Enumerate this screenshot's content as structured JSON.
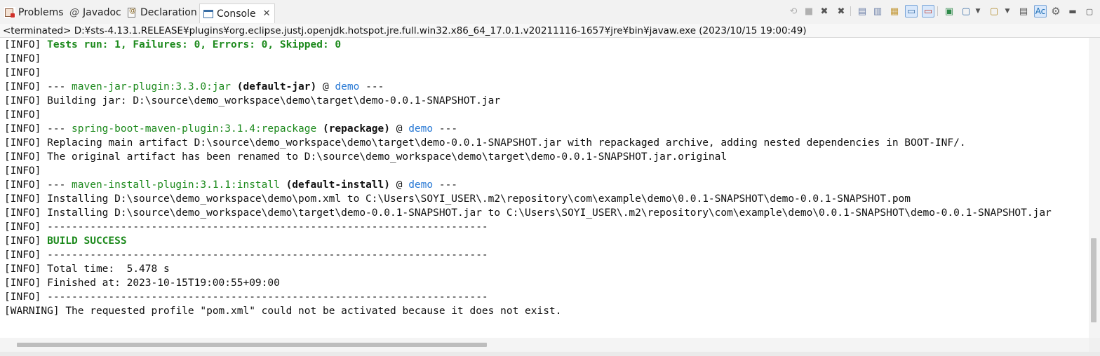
{
  "tabs": {
    "problems": "Problems",
    "javadoc": "Javadoc",
    "declaration": "Declaration",
    "console": "Console",
    "close": "✕"
  },
  "toolbar_icons": [
    "remove-launch-icon",
    "terminate-icon",
    "remove-all-terminated-icon",
    "remove-all-icon",
    "scroll-lock-icon",
    "word-wrap-icon",
    "show-when-stdout-icon",
    "show-when-stderr-icon",
    "pin-console-icon",
    "display-selected-console-icon",
    "open-console-icon",
    "view-menu-icon",
    "settings-icon",
    "minimize-icon",
    "maximize-icon"
  ],
  "status": "<terminated> D:¥sts-4.13.1.RELEASE¥plugins¥org.eclipse.justj.openjdk.hotspot.jre.full.win32.x86_64_17.0.1.v20211116-1657¥jre¥bin¥javaw.exe  (2023/10/15 19:00:49)",
  "console": {
    "prefix": "[INFO] ",
    "warn_prefix": "[WARNING] ",
    "tests_line": "Tests run: 1, Failures: 0, Errors: 0, Skipped: 0",
    "jar_plugin": {
      "dashes": "--- ",
      "plugin": "maven-jar-plugin:3.3.0:jar",
      "goal": "(default-jar)",
      "at": " @ ",
      "project": "demo",
      "tail": " ---"
    },
    "building_jar": "Building jar: D:\\source\\demo_workspace\\demo\\target\\demo-0.0.1-SNAPSHOT.jar",
    "boot_plugin": {
      "dashes": "--- ",
      "plugin": "spring-boot-maven-plugin:3.1.4:repackage",
      "goal": "(repackage)",
      "at": " @ ",
      "project": "demo",
      "tail": " ---"
    },
    "replacing": "Replacing main artifact D:\\source\\demo_workspace\\demo\\target\\demo-0.0.1-SNAPSHOT.jar with repackaged archive, adding nested dependencies in BOOT-INF/.",
    "renamed": "The original artifact has been renamed to D:\\source\\demo_workspace\\demo\\target\\demo-0.0.1-SNAPSHOT.jar.original",
    "install_plugin": {
      "dashes": "--- ",
      "plugin": "maven-install-plugin:3.1.1:install",
      "goal": "(default-install)",
      "at": " @ ",
      "project": "demo",
      "tail": " ---"
    },
    "installing_pom": "Installing D:\\source\\demo_workspace\\demo\\pom.xml to C:\\Users\\SOYI_USER\\.m2\\repository\\com\\example\\demo\\0.0.1-SNAPSHOT\\demo-0.0.1-SNAPSHOT.pom",
    "installing_jar": "Installing D:\\source\\demo_workspace\\demo\\target\\demo-0.0.1-SNAPSHOT.jar to C:\\Users\\SOYI_USER\\.m2\\repository\\com\\example\\demo\\0.0.1-SNAPSHOT\\demo-0.0.1-SNAPSHOT.jar",
    "separator": "------------------------------------------------------------------------",
    "build_success": "BUILD SUCCESS",
    "total_time": "Total time:  5.478 s",
    "finished_at": "Finished at: 2023-10-15T19:00:55+09:00",
    "warning": "The requested profile \"pom.xml\" could not be activated because it does not exist."
  }
}
